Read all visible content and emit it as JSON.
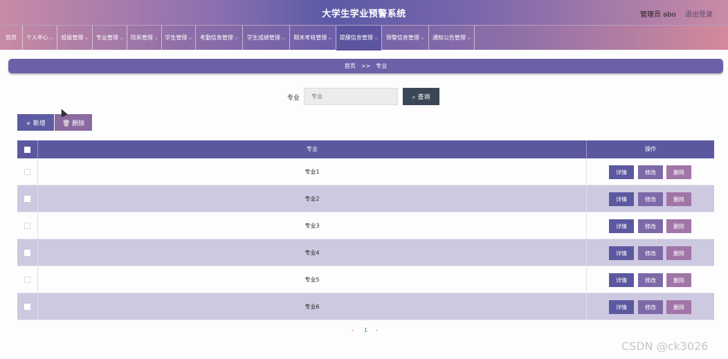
{
  "header": {
    "title": "大学生学业预警系统",
    "user": "管理员 abo",
    "logout": "退出登录"
  },
  "nav": {
    "items": [
      {
        "label": "首页",
        "has_menu": false
      },
      {
        "label": "个人中心",
        "has_menu": true
      },
      {
        "label": "班级管理",
        "has_menu": true
      },
      {
        "label": "专业管理",
        "has_menu": true
      },
      {
        "label": "院系管理",
        "has_menu": true
      },
      {
        "label": "学生管理",
        "has_menu": true
      },
      {
        "label": "考勤信息管理",
        "has_menu": true
      },
      {
        "label": "学生成绩管理",
        "has_menu": true
      },
      {
        "label": "期末考核管理",
        "has_menu": true
      },
      {
        "label": "提醒信息管理",
        "has_menu": true,
        "active": true
      },
      {
        "label": "预警信息管理",
        "has_menu": true
      },
      {
        "label": "通知公告管理",
        "has_menu": true
      }
    ]
  },
  "breadcrumb": {
    "home": "首页",
    "sep": ">>",
    "current": "专业"
  },
  "search": {
    "label": "专业",
    "placeholder": "专业",
    "button": "查询"
  },
  "toolbar": {
    "add": "新增",
    "delete": "删除"
  },
  "table": {
    "headers": {
      "name": "专业",
      "ops": "操作"
    },
    "rows": [
      {
        "name": "专业1"
      },
      {
        "name": "专业2"
      },
      {
        "name": "专业3"
      },
      {
        "name": "专业4"
      },
      {
        "name": "专业5"
      },
      {
        "name": "专业6"
      }
    ],
    "actions": {
      "detail": "详情",
      "edit": "修改",
      "delete": "删除"
    }
  },
  "pagination": {
    "prev": "‹",
    "current": "1",
    "next": "›"
  },
  "watermark": "CSDN @ck3026",
  "colors": {
    "primary": "#5c58a0",
    "row_alt": "#ccc9e0",
    "search_btn": "#3b4756"
  }
}
